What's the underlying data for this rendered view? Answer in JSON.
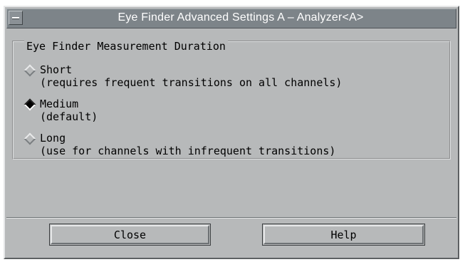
{
  "window": {
    "title": "Eye Finder Advanced Settings A – Analyzer<A>",
    "menu_icon": "window-menu-icon"
  },
  "group": {
    "legend": "Eye Finder Measurement Duration",
    "options": [
      {
        "label": "Short",
        "description": "(requires frequent transitions on all channels)",
        "selected": false
      },
      {
        "label": "Medium",
        "description": "(default)",
        "selected": true
      },
      {
        "label": "Long",
        "description": "(use for channels with infrequent transitions)",
        "selected": false
      }
    ]
  },
  "buttons": {
    "close": "Close",
    "help": "Help"
  }
}
